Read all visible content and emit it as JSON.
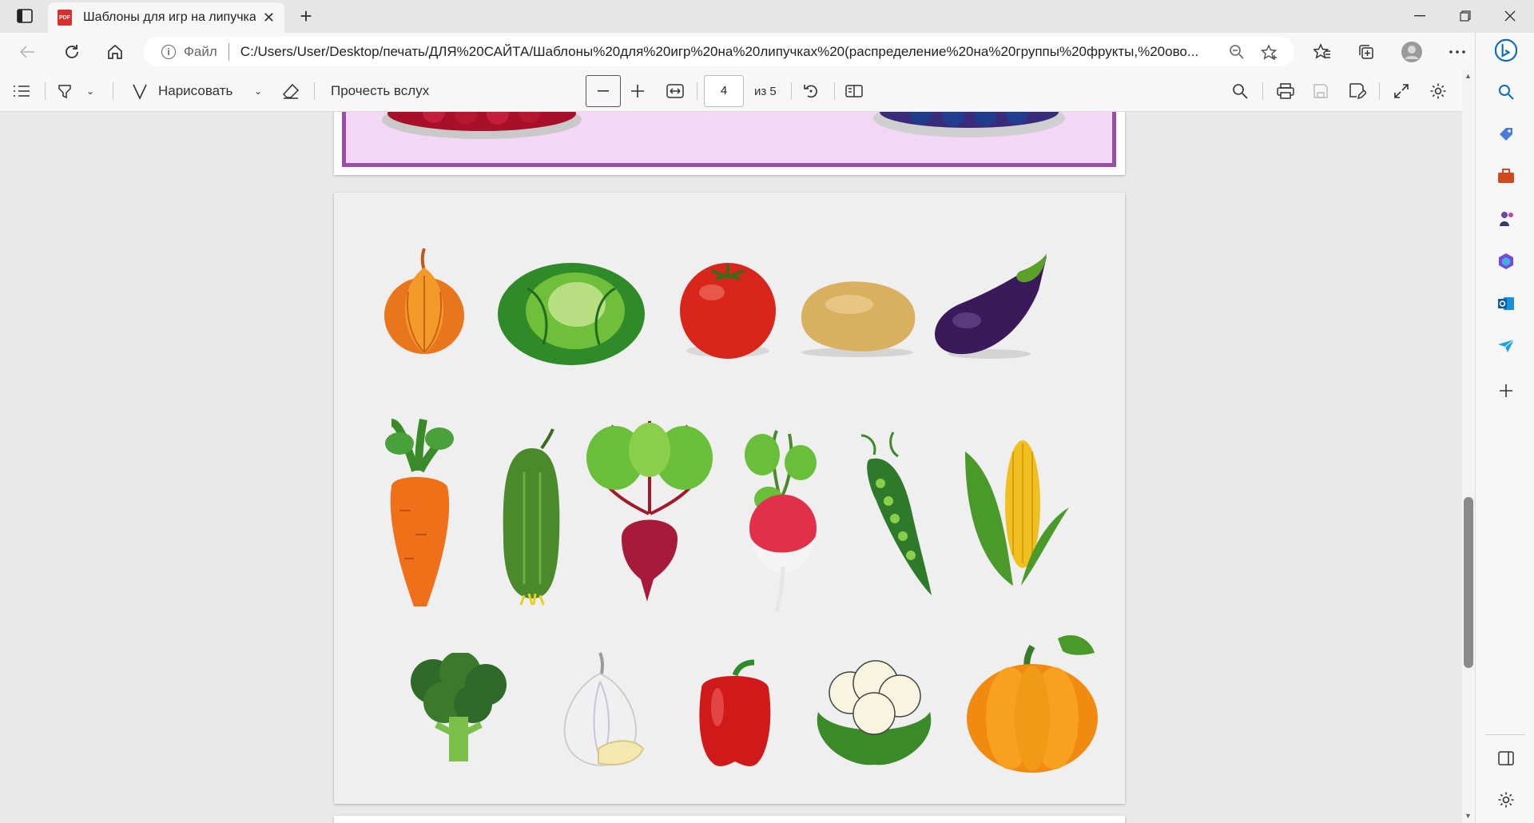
{
  "tab": {
    "title": "Шаблоны для игр на липучках (",
    "icon": "pdf-file-icon"
  },
  "address": {
    "scheme_label": "Файл",
    "url": "C:/Users/User/Desktop/печать/ДЛЯ%20САЙТА/Шаблоны%20для%20игр%20на%20липучках%20(распределение%20на%20группы%20фрукты,%20ово..."
  },
  "pdf_toolbar": {
    "draw_label": "Нарисовать",
    "read_aloud_label": "Прочесть вслух",
    "page_number": "4",
    "page_total": "из 5"
  },
  "document": {
    "items": [
      "onion",
      "cabbage",
      "tomato",
      "potato",
      "eggplant",
      "carrot",
      "cucumber",
      "beet",
      "radish",
      "peas",
      "corn",
      "broccoli",
      "garlic",
      "bell-pepper",
      "cauliflower",
      "pumpkin"
    ]
  },
  "colors": {
    "accent": "#0f6cbd",
    "frame_purple": "#9b4ea6",
    "frame_fill": "#f4d6f7"
  }
}
